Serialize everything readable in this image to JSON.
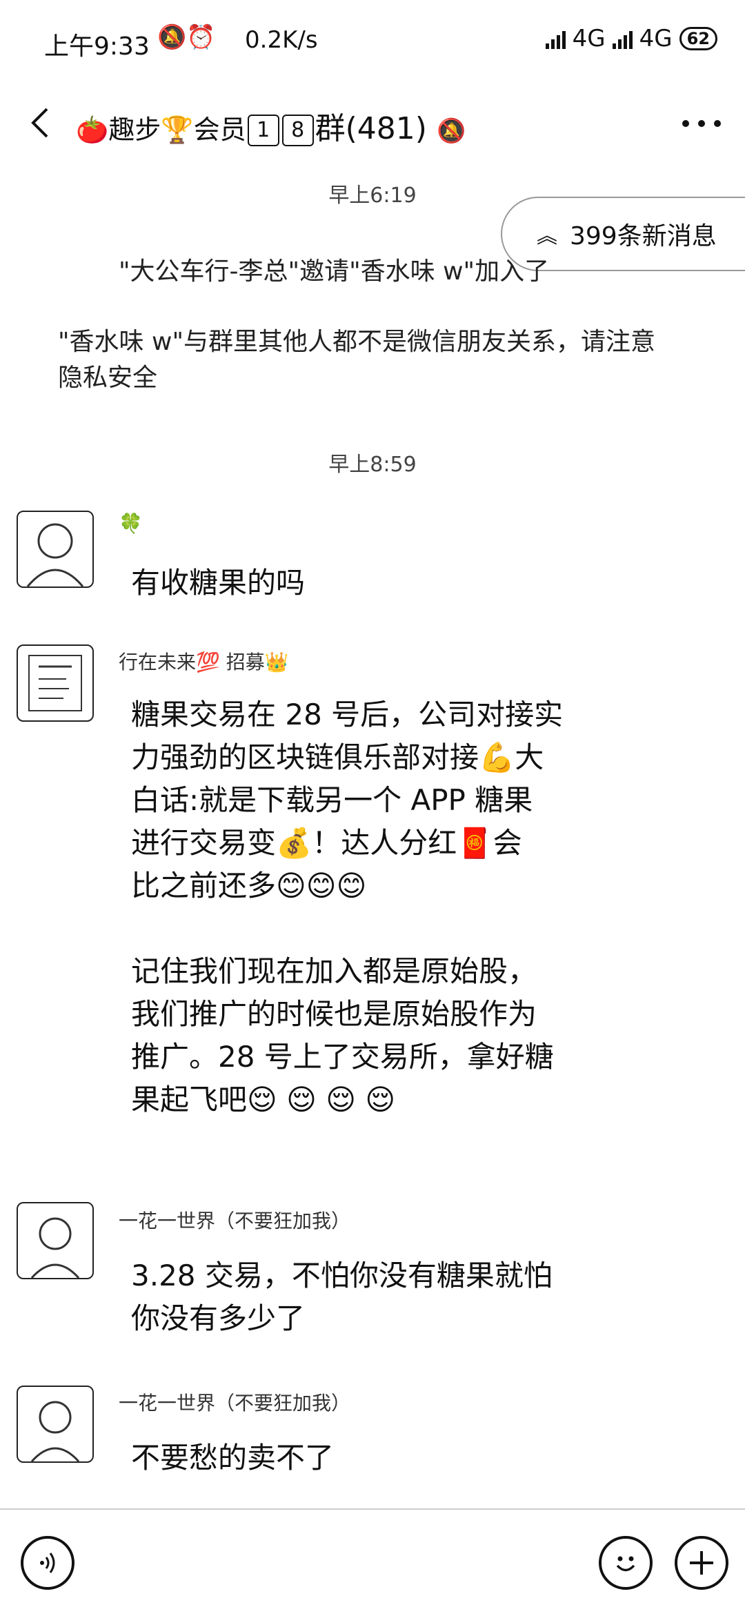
{
  "status_bar": {
    "time": "上午9:33",
    "icons": "🔕⏰",
    "net_speed": "0.2K/s",
    "network1": "4G",
    "network2": "4G",
    "battery": "62"
  },
  "header": {
    "title_prefix": "🍅趣步🏆会员",
    "num1": "1",
    "num2": "8",
    "title_suffix": "群(481)"
  },
  "new_messages_label": "399条新消息",
  "chat": {
    "timestamp1": "早上6:19",
    "system1": "\"大公车行-李总\"邀请\"香水味 w\"加入了群聊",
    "system2_line1": "\"香水味 w\"与群里其他人都不是微信朋友关系，请注意",
    "system2_line2": "隐私安全",
    "timestamp2": "早上8:59",
    "messages": [
      {
        "sender": "🍀",
        "lines": [
          "有收糖果的吗"
        ]
      },
      {
        "sender": "行在未来💯 招募👑",
        "lines": [
          "糖果交易在 28 号后，公司对接实",
          "力强劲的区块链俱乐部对接💪大",
          "白话:就是下载另一个 APP 糖果",
          "进行交易变💰！达人分红🧧会",
          "比之前还多😊😊😊",
          "",
          "记住我们现在加入都是原始股，",
          "我们推广的时候也是原始股作为",
          "推广。28 号上了交易所，拿好糖",
          "果起飞吧😌 😌 😌 😌"
        ]
      },
      {
        "sender": "一花一世界（不要狂加我）",
        "lines": [
          "3.28 交易，不怕你没有糖果就怕",
          "你没有多少了"
        ]
      },
      {
        "sender": "一花一世界（不要狂加我）",
        "lines": [
          "不要愁的卖不了"
        ]
      }
    ]
  }
}
